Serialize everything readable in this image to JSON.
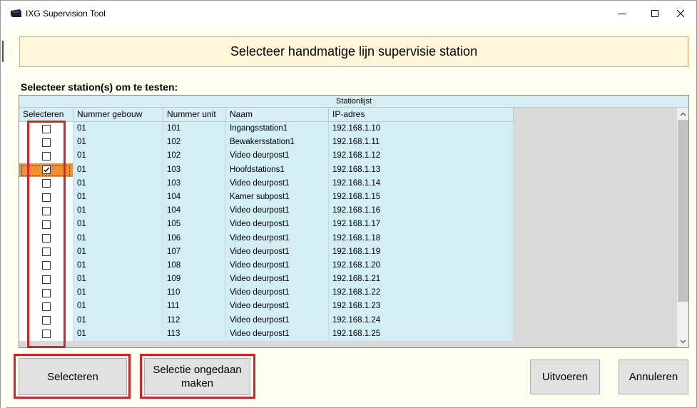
{
  "window": {
    "title": "IXG Supervision Tool",
    "minimize_glyph": "—",
    "maximize_glyph": "☐",
    "close_glyph": "✕"
  },
  "header": {
    "title": "Selecteer handmatige lijn supervisie station"
  },
  "subtitle": "Selecteer station(s) om te testen:",
  "grid": {
    "caption": "Stationlijst",
    "columns": [
      "Selecteren",
      "Nummer gebouw",
      "Nummer unit",
      "Naam",
      "IP-adres"
    ],
    "rows": [
      {
        "checked": false,
        "building": "01",
        "unit": "101",
        "name": "Ingangsstation1",
        "ip": "192.168.1.10"
      },
      {
        "checked": false,
        "building": "01",
        "unit": "102",
        "name": "Bewakersstation1",
        "ip": "192.168.1.11"
      },
      {
        "checked": false,
        "building": "01",
        "unit": "102",
        "name": "Video deurpost1",
        "ip": "192.168.1.12"
      },
      {
        "checked": true,
        "building": "01",
        "unit": "103",
        "name": "Hoofdstations1",
        "ip": "192.168.1.13"
      },
      {
        "checked": false,
        "building": "01",
        "unit": "103",
        "name": "Video deurpost1",
        "ip": "192.168.1.14"
      },
      {
        "checked": false,
        "building": "01",
        "unit": "104",
        "name": "Kamer subpost1",
        "ip": "192.168.1.15"
      },
      {
        "checked": false,
        "building": "01",
        "unit": "104",
        "name": "Video deurpost1",
        "ip": "192.168.1.16"
      },
      {
        "checked": false,
        "building": "01",
        "unit": "105",
        "name": "Video deurpost1",
        "ip": "192.168.1.17"
      },
      {
        "checked": false,
        "building": "01",
        "unit": "106",
        "name": "Video deurpost1",
        "ip": "192.168.1.18"
      },
      {
        "checked": false,
        "building": "01",
        "unit": "107",
        "name": "Video deurpost1",
        "ip": "192.168.1.19"
      },
      {
        "checked": false,
        "building": "01",
        "unit": "108",
        "name": "Video deurpost1",
        "ip": "192.168.1.20"
      },
      {
        "checked": false,
        "building": "01",
        "unit": "109",
        "name": "Video deurpost1",
        "ip": "192.168.1.21"
      },
      {
        "checked": false,
        "building": "01",
        "unit": "110",
        "name": "Video deurpost1",
        "ip": "192.168.1.22"
      },
      {
        "checked": false,
        "building": "01",
        "unit": "111",
        "name": "Video deurpost1",
        "ip": "192.168.1.23"
      },
      {
        "checked": false,
        "building": "01",
        "unit": "112",
        "name": "Video deurpost1",
        "ip": "192.168.1.24"
      },
      {
        "checked": false,
        "building": "01",
        "unit": "113",
        "name": "Video deurpost1",
        "ip": "192.168.1.25"
      }
    ]
  },
  "buttons": {
    "select": "Selecteren",
    "undo_line1": "Selectie ongedaan",
    "undo_line2": "maken",
    "execute": "Uitvoeren",
    "cancel": "Annuleren"
  },
  "colors": {
    "highlight": "#d4252d",
    "selected_row": "#f0912f",
    "header_border": "#f2a55b",
    "header_bg": "#fff5d9",
    "grid_cell": "#d2eef4"
  },
  "icons": {
    "app": "app-logo-icon",
    "check": "checkmark-icon",
    "scroll_up": "chevron-up-icon",
    "scroll_down": "chevron-down-icon"
  }
}
